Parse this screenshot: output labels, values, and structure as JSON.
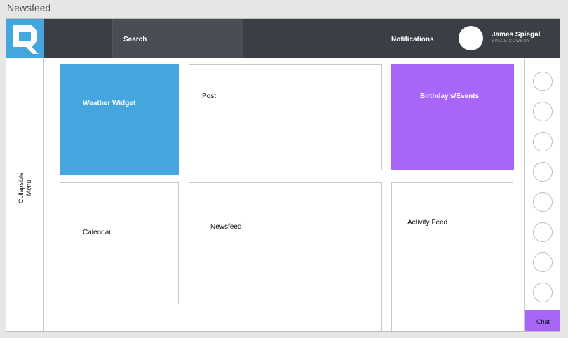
{
  "window": {
    "title": "Newsfeed"
  },
  "topbar": {
    "search_label": "Search",
    "notifications_label": "Notifications",
    "user": {
      "name": "James Spiegal",
      "subtitle": "SPACE COWBOY"
    }
  },
  "left_menu": {
    "label_line1": "Collapsible",
    "label_line2": "Menu"
  },
  "widgets": {
    "weather": "Weather Widget",
    "post": "Post",
    "events": "Birthday's/Events",
    "calendar": "Calendar",
    "newsfeed": "Newsfeed",
    "activity": "Activity Feed"
  },
  "chat": {
    "label": "Chat",
    "contact_count": 8
  },
  "colors": {
    "topbar": "#3b3e45",
    "blue": "#45a5de",
    "purple": "#a965f7"
  }
}
